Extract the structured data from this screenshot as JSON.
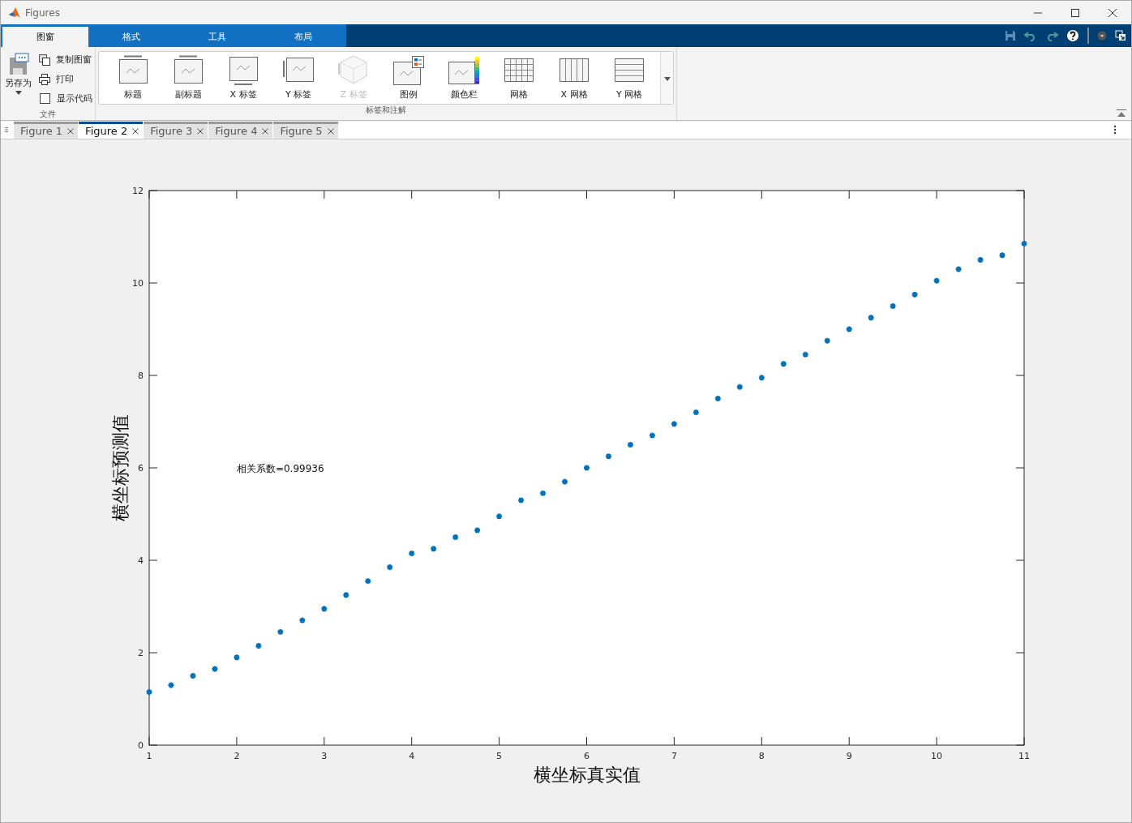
{
  "window": {
    "title": "Figures"
  },
  "ribbon_tabs": [
    {
      "label": "图窗",
      "selected": true
    },
    {
      "label": "格式",
      "selected": false
    },
    {
      "label": "工具",
      "selected": false
    },
    {
      "label": "布局",
      "selected": false
    }
  ],
  "file_section": {
    "label": "文件",
    "save_as": "另存为",
    "actions": [
      {
        "kind": "copy",
        "label": "复制图窗"
      },
      {
        "kind": "print",
        "label": "打印"
      }
    ],
    "show_code": {
      "label": "显示代码",
      "checked": false
    }
  },
  "annotate_section": {
    "label": "标签和注解",
    "buttons": [
      {
        "kind": "title",
        "label": "标题",
        "disabled": false
      },
      {
        "kind": "subtitle",
        "label": "副标题",
        "disabled": false
      },
      {
        "kind": "xlabel",
        "label": "X 标签",
        "disabled": false
      },
      {
        "kind": "ylabel",
        "label": "Y 标签",
        "disabled": false
      },
      {
        "kind": "zlabel",
        "label": "Z 标签",
        "disabled": true
      },
      {
        "kind": "legend",
        "label": "图例",
        "disabled": false
      },
      {
        "kind": "colorbar",
        "label": "颜色栏",
        "disabled": false
      },
      {
        "kind": "grid",
        "label": "网格",
        "disabled": false
      },
      {
        "kind": "xgrid",
        "label": "X 网格",
        "disabled": false
      },
      {
        "kind": "ygrid",
        "label": "Y 网格",
        "disabled": false
      }
    ]
  },
  "figure_tabs": [
    {
      "label": "Figure 1",
      "selected": false
    },
    {
      "label": "Figure 2",
      "selected": true
    },
    {
      "label": "Figure 3",
      "selected": false
    },
    {
      "label": "Figure 4",
      "selected": false
    },
    {
      "label": "Figure 5",
      "selected": false
    }
  ],
  "figure": {
    "annotation": "相关系数=0.99936",
    "chart_data": {
      "type": "scatter",
      "xlabel": "横坐标真实值",
      "ylabel": "横坐标预测值",
      "x": [
        1,
        1.25,
        1.5,
        1.75,
        2,
        2.25,
        2.5,
        2.75,
        3,
        3.25,
        3.5,
        3.75,
        4,
        4.25,
        4.5,
        4.75,
        5,
        5.25,
        5.5,
        5.75,
        6,
        6.25,
        6.5,
        6.75,
        7,
        7.25,
        7.5,
        7.75,
        8,
        8.25,
        8.5,
        8.75,
        9,
        9.25,
        9.5,
        9.75,
        10,
        10.25,
        10.5,
        10.75,
        11
      ],
      "series": [
        {
          "color": "#0072bd",
          "values": [
            1.15,
            1.3,
            1.5,
            1.65,
            1.9,
            2.15,
            2.45,
            2.7,
            2.95,
            3.25,
            3.55,
            3.85,
            4.15,
            4.25,
            4.5,
            4.65,
            4.95,
            5.3,
            5.45,
            5.7,
            6.0,
            6.25,
            6.5,
            6.7,
            6.95,
            7.2,
            7.5,
            7.75,
            7.95,
            8.25,
            8.45,
            8.75,
            9.0,
            9.25,
            9.5,
            9.75,
            10.05,
            10.3,
            10.5,
            10.6,
            10.85
          ]
        }
      ],
      "xlim": [
        1,
        11
      ],
      "ylim": [
        0,
        12
      ],
      "xticks": [
        1,
        2,
        3,
        4,
        5,
        6,
        7,
        8,
        9,
        10,
        11
      ],
      "yticks": [
        0,
        2,
        4,
        6,
        8,
        10,
        12
      ]
    }
  }
}
